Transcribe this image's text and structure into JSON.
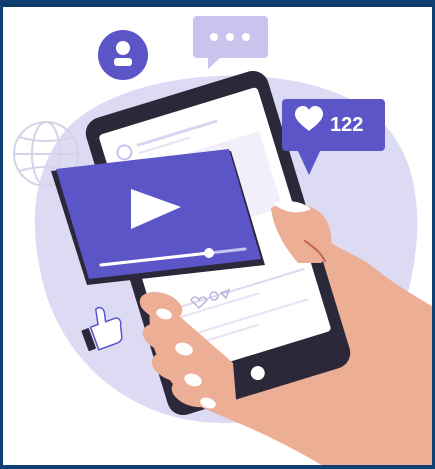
{
  "illustration": {
    "like_notification": {
      "icon": "heart-icon",
      "count": "122"
    },
    "chat_bubble_icon": "ellipsis-chat-icon",
    "profile_icon": "user-icon",
    "globe_icon": "globe-icon",
    "thumbs_up_icon": "thumbs-up-icon",
    "video_card": {
      "icon": "play-icon",
      "progress": 0.72
    },
    "colors": {
      "accent_purple": "#5b55c8",
      "light_purple": "#c9c4ee",
      "blob_lavender": "#dddaf4",
      "phone_dark": "#2b2839",
      "skin": "#ecae95",
      "frame_blue": "#0f3f73"
    }
  }
}
